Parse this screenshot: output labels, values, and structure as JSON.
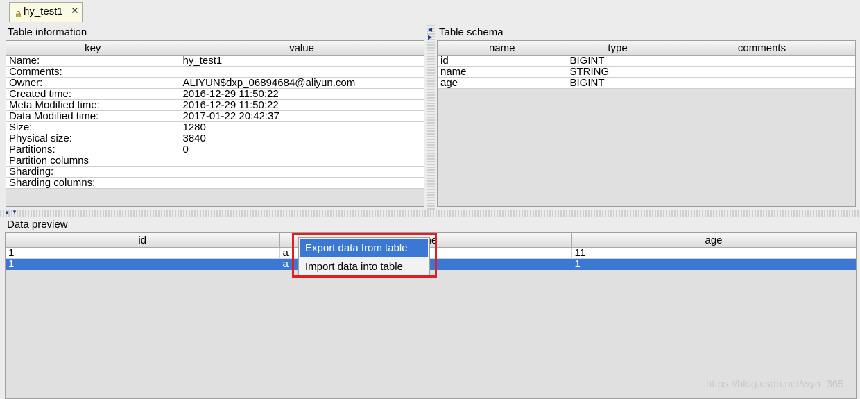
{
  "tab": {
    "title": "hy_test1",
    "close": "✕",
    "icon": "lock-icon"
  },
  "table_info": {
    "title": "Table information",
    "columns": [
      "key",
      "value"
    ],
    "rows": [
      [
        "Name:",
        "hy_test1"
      ],
      [
        "Comments:",
        ""
      ],
      [
        "Owner:",
        "ALIYUN$dxp_06894684@aliyun.com"
      ],
      [
        "Created time:",
        "2016-12-29 11:50:22"
      ],
      [
        "Meta Modified time:",
        "2016-12-29 11:50:22"
      ],
      [
        "Data Modified time:",
        "2017-01-22 20:42:37"
      ],
      [
        "Size:",
        "1280"
      ],
      [
        "Physical size:",
        "3840"
      ],
      [
        "Partitions:",
        "0"
      ],
      [
        "Partition columns",
        ""
      ],
      [
        "Sharding:",
        ""
      ],
      [
        "Sharding columns:",
        ""
      ]
    ]
  },
  "schema": {
    "title": "Table schema",
    "columns": [
      "name",
      "type",
      "comments"
    ],
    "rows": [
      [
        "id",
        "BIGINT",
        ""
      ],
      [
        "name",
        "STRING",
        ""
      ],
      [
        "age",
        "BIGINT",
        ""
      ]
    ]
  },
  "preview": {
    "title": "Data preview",
    "columns": [
      "id",
      "ne",
      "age"
    ],
    "rows": [
      [
        "1",
        "a",
        "11"
      ],
      [
        "1",
        "a",
        "1"
      ]
    ],
    "selected_row": 1
  },
  "context_menu": {
    "items": [
      "Export data from table",
      "Import data into table"
    ],
    "active_index": 0
  },
  "watermark": "https://blog.csdn.net/wyn_365",
  "colors": {
    "selection": "#3a78d4",
    "highlight_box": "#e02020",
    "tab_bg": "#fbfbe4"
  }
}
